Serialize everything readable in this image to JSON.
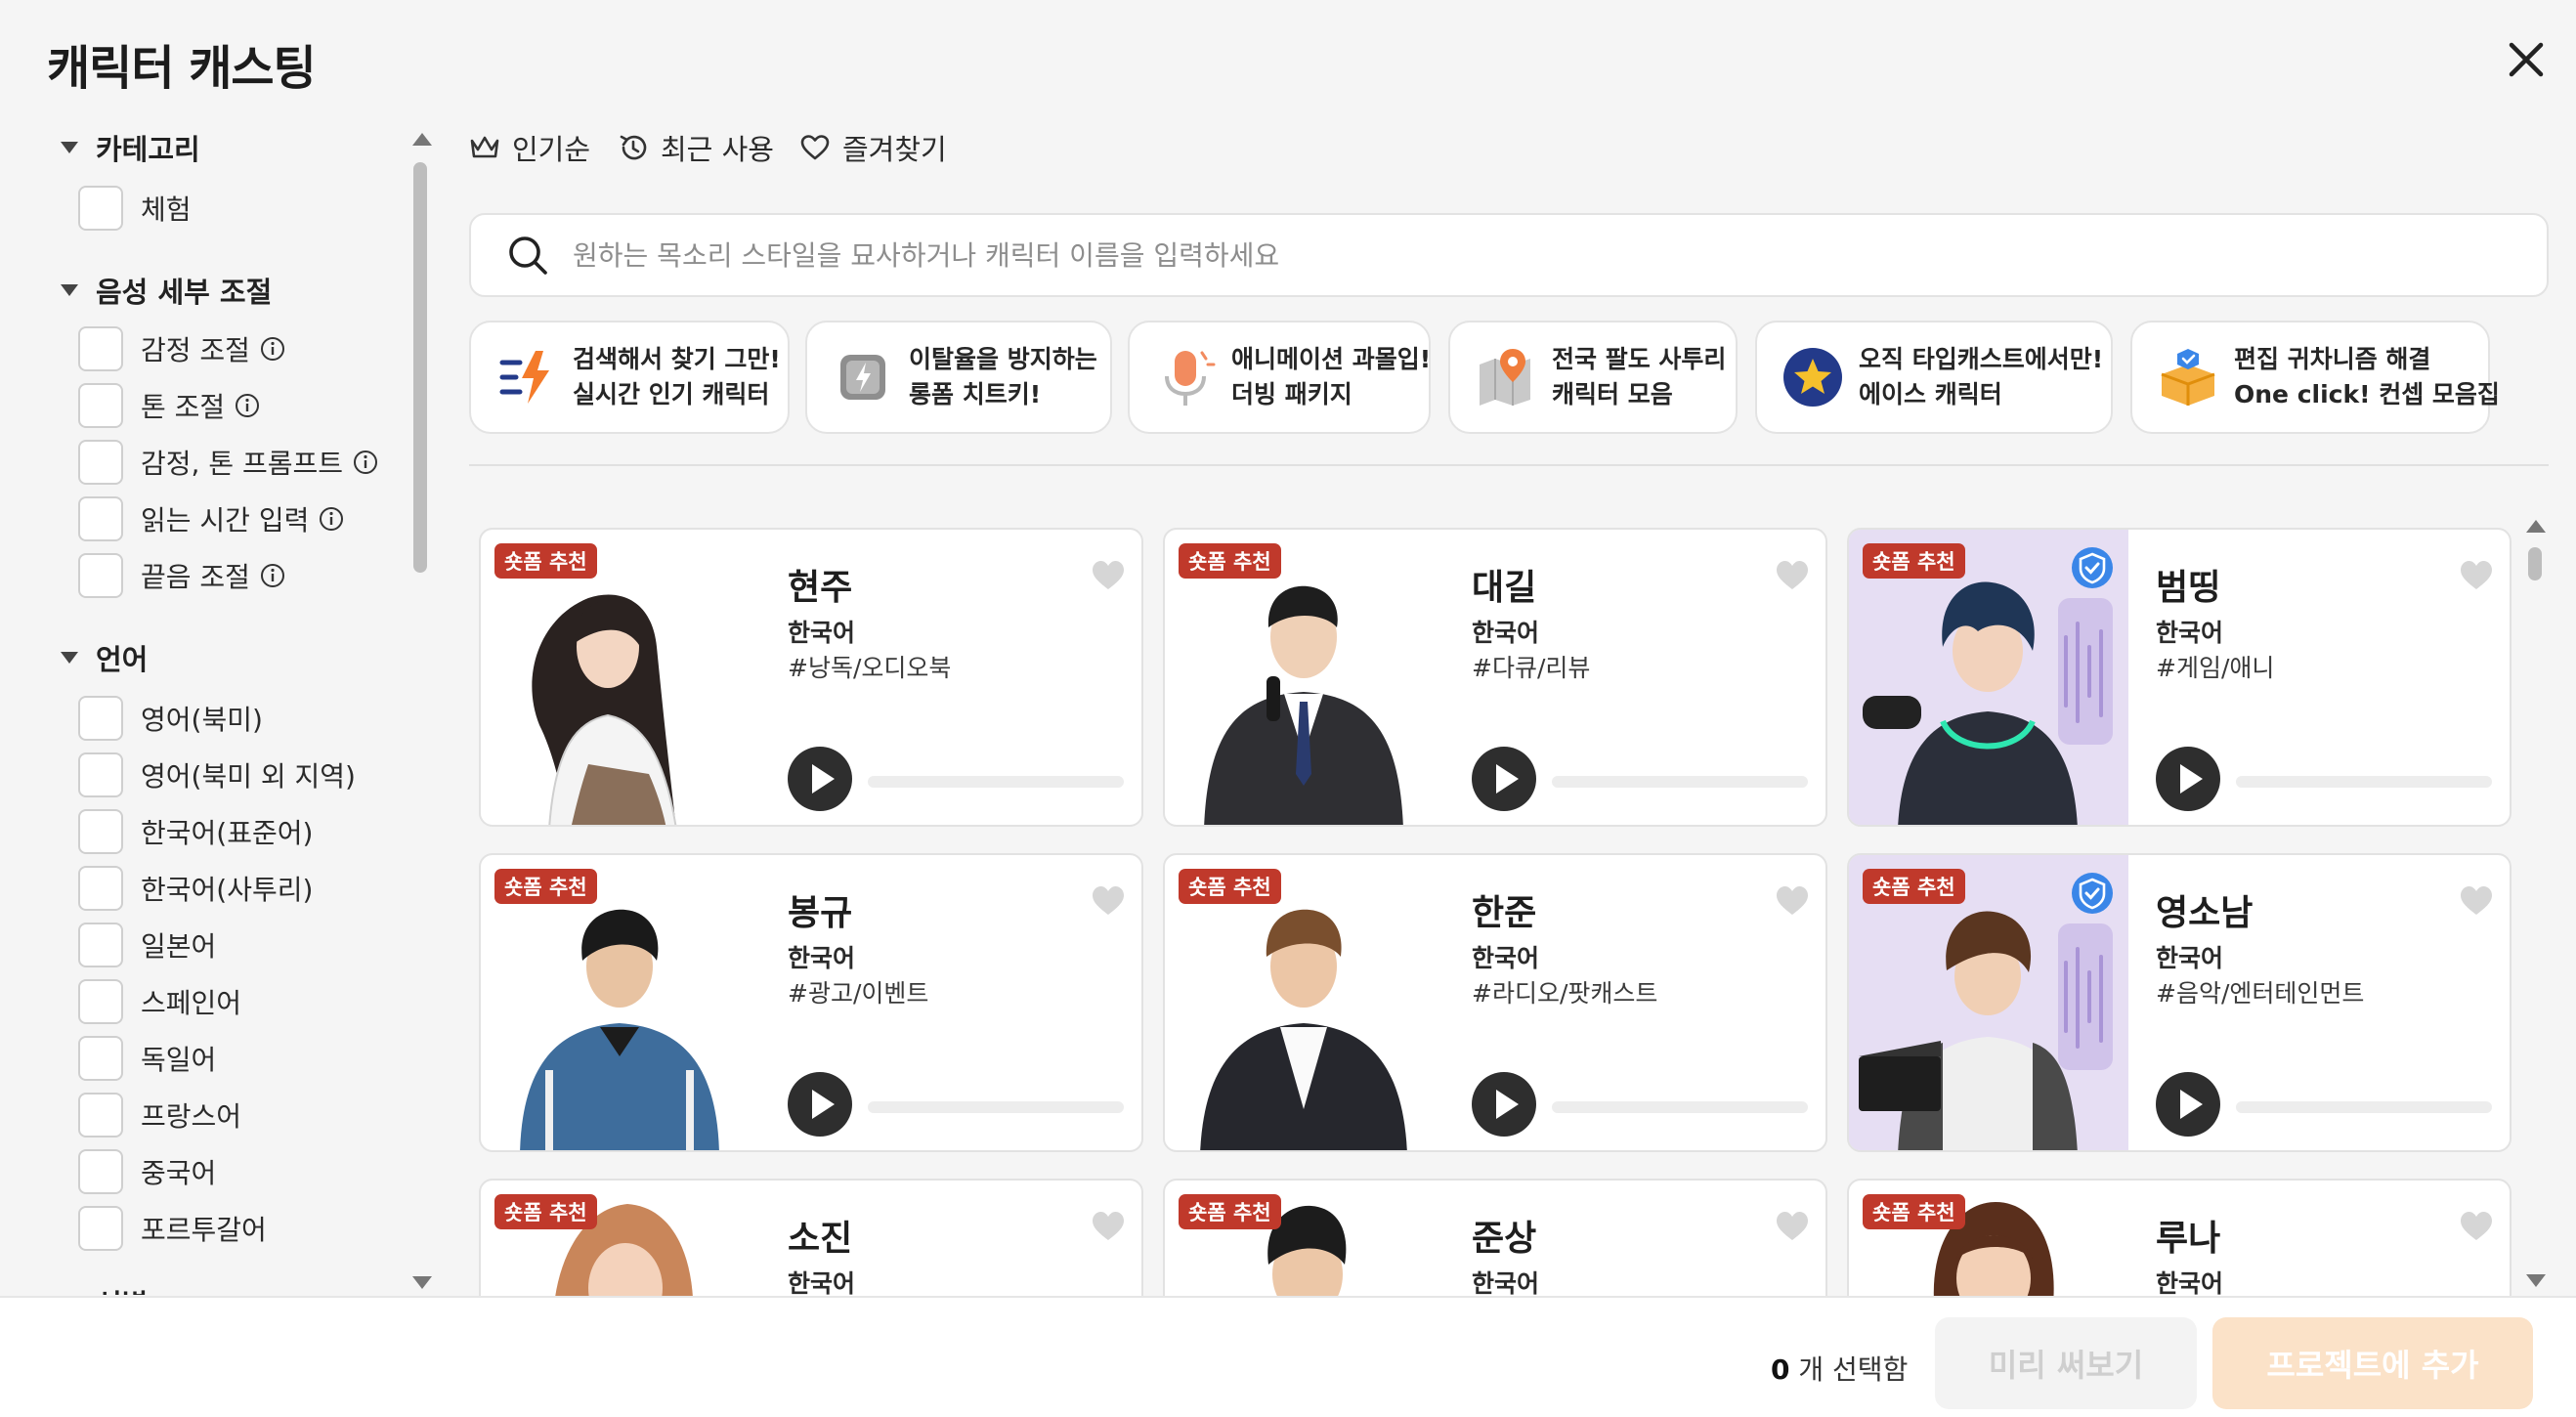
{
  "dialog": {
    "title": "캐릭터 캐스팅",
    "close_icon": "close-icon"
  },
  "sidebar": {
    "sections": [
      {
        "label": "카테고리",
        "options": [
          "체험"
        ]
      },
      {
        "label": "음성 세부 조절",
        "options": [
          "감정 조절",
          "톤 조절",
          "감정, 톤 프롬프트",
          "읽는 시간 입력",
          "끝음 조절"
        ]
      },
      {
        "label": "언어",
        "options": [
          "영어(북미)",
          "영어(북미 외 지역)",
          "한국어(표준어)",
          "한국어(사투리)",
          "일본어",
          "스페인어",
          "독일어",
          "프랑스어",
          "중국어",
          "포르투갈어"
        ]
      },
      {
        "label": "성별"
      }
    ]
  },
  "tabs": [
    {
      "label": "인기순",
      "icon": "crown-icon"
    },
    {
      "label": "최근 사용",
      "icon": "history-icon"
    },
    {
      "label": "즐겨찾기",
      "icon": "heart-icon"
    }
  ],
  "search": {
    "placeholder": "원하는 목소리 스타일을 묘사하거나 캐릭터 이름을 입력하세요"
  },
  "chips": [
    {
      "line1": "검색해서 찾기 그만!",
      "line2": "실시간 인기 캐릭터",
      "icon": "trending-icon"
    },
    {
      "line1": "이탈율을 방지하는",
      "line2": "롱폼 치트키!",
      "icon": "lightning-icon"
    },
    {
      "line1": "애니메이션 과몰입!",
      "line2": "더빙 패키지",
      "icon": "microphone-icon"
    },
    {
      "line1": "전국 팔도 사투리",
      "line2": "캐릭터 모음",
      "icon": "map-pin-icon"
    },
    {
      "line1": "오직 타입캐스트에서만!",
      "line2": "에이스 캐릭터",
      "icon": "star-icon"
    },
    {
      "line1": "편집 귀차니즘 해결",
      "line2": "One click! 컨셉 모음집",
      "icon": "gift-box-icon"
    }
  ],
  "cards": [
    {
      "badge": "숏폼 추천",
      "name": "현주",
      "lang": "한국어",
      "tag": "#낭독/오디오북",
      "verified": false
    },
    {
      "badge": "숏폼 추천",
      "name": "대길",
      "lang": "한국어",
      "tag": "#다큐/리뷰",
      "verified": false
    },
    {
      "badge": "숏폼 추천",
      "name": "범띵",
      "lang": "한국어",
      "tag": "#게임/애니",
      "verified": true
    },
    {
      "badge": "숏폼 추천",
      "name": "봉규",
      "lang": "한국어",
      "tag": "#광고/이벤트",
      "verified": false
    },
    {
      "badge": "숏폼 추천",
      "name": "한준",
      "lang": "한국어",
      "tag": "#라디오/팟캐스트",
      "verified": false
    },
    {
      "badge": "숏폼 추천",
      "name": "영소남",
      "lang": "한국어",
      "tag": "#음악/엔터테인먼트",
      "verified": true
    },
    {
      "badge": "숏폼 추천",
      "name": "소진",
      "lang": "한국어",
      "tag": "",
      "verified": false
    },
    {
      "badge": "숏폼 추천",
      "name": "준상",
      "lang": "한국어",
      "tag": "",
      "verified": false
    },
    {
      "badge": "숏폼 추천",
      "name": "루나",
      "lang": "한국어",
      "tag": "",
      "verified": false
    }
  ],
  "footer": {
    "count": "0",
    "count_suffix": " 개 선택함",
    "preview_label": "미리 써보기",
    "add_label": "프로젝트에 추가"
  },
  "colors": {
    "badge": "#c0392b",
    "accent_disabled": "#fbe2c8",
    "verified": "#3a86e8"
  }
}
